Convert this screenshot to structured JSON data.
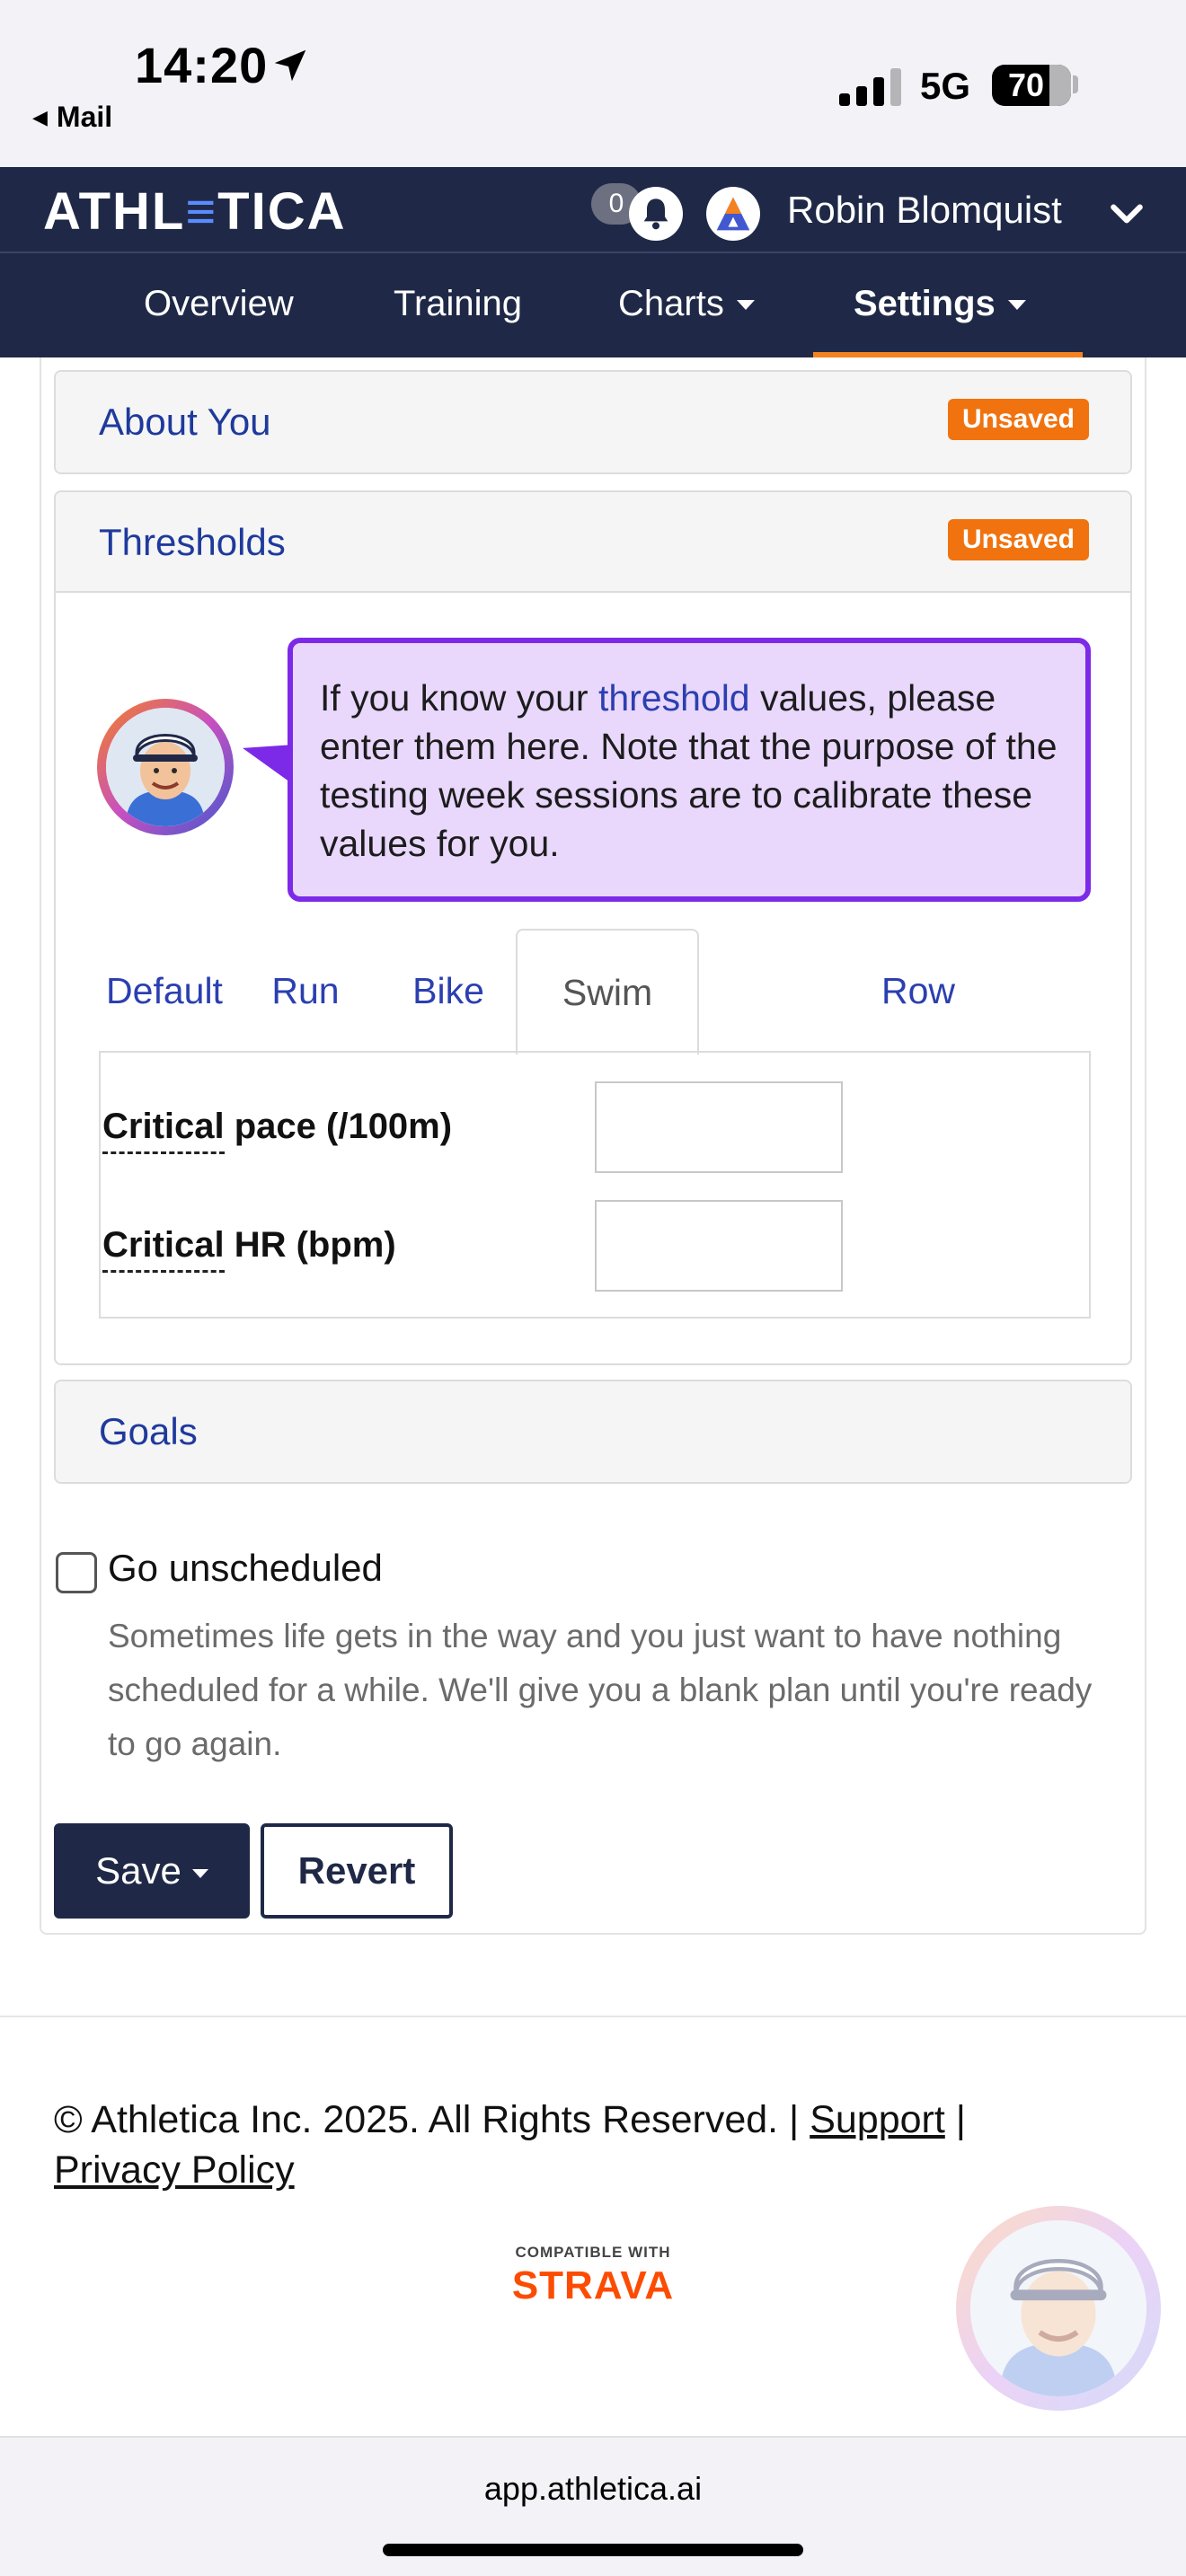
{
  "status_bar": {
    "time": "14:20",
    "back_app": "Mail",
    "network": "5G",
    "battery": "70"
  },
  "header": {
    "logo": "ATHLETICA",
    "notification_count": "0",
    "user_name": "Robin Blomquist"
  },
  "nav": {
    "items": [
      {
        "label": "Overview"
      },
      {
        "label": "Training"
      },
      {
        "label": "Charts"
      },
      {
        "label": "Settings"
      }
    ],
    "active": "Settings"
  },
  "panels": {
    "about": {
      "title": "About You",
      "badge": "Unsaved"
    },
    "thresholds": {
      "title": "Thresholds",
      "badge": "Unsaved"
    },
    "goals": {
      "title": "Goals"
    }
  },
  "coach_message": {
    "before": "If you know your ",
    "link": "threshold",
    "after": " values, please enter them here. Note that the purpose of the testing week sessions are to calibrate these values for you."
  },
  "sport_tabs": [
    {
      "label": "Default"
    },
    {
      "label": "Run"
    },
    {
      "label": "Bike"
    },
    {
      "label": "Swim"
    },
    {
      "label": "Row"
    }
  ],
  "active_tab": "Swim",
  "swim_fields": {
    "critical_pace": {
      "label_a": "Critical",
      "label_b": " pace (/100m)",
      "value": ""
    },
    "critical_hr": {
      "label_a": "Critical",
      "label_b": " HR (bpm)",
      "value": ""
    }
  },
  "unscheduled": {
    "label": "Go unscheduled",
    "checked": false,
    "help": "Sometimes life gets in the way and you just want to have nothing scheduled for a while. We'll give you a blank plan until you're ready to go again."
  },
  "actions": {
    "save": "Save",
    "revert": "Revert"
  },
  "footer": {
    "copyright": "© Athletica Inc. 2025. All Rights Reserved. |",
    "support": "Support",
    "separator": "|",
    "privacy": "Privacy Policy",
    "strava_compat": "COMPATIBLE WITH",
    "strava_name": "STRAVA"
  },
  "browser": {
    "url": "app.athletica.ai"
  },
  "colors": {
    "brand_navy": "#1f2947",
    "accent_orange": "#f58220",
    "badge_orange": "#f0730f",
    "link_blue": "#1f3a9c",
    "coach_bubble": "#e9d8fb",
    "coach_border": "#7c2ae8",
    "strava": "#fc4c02"
  }
}
